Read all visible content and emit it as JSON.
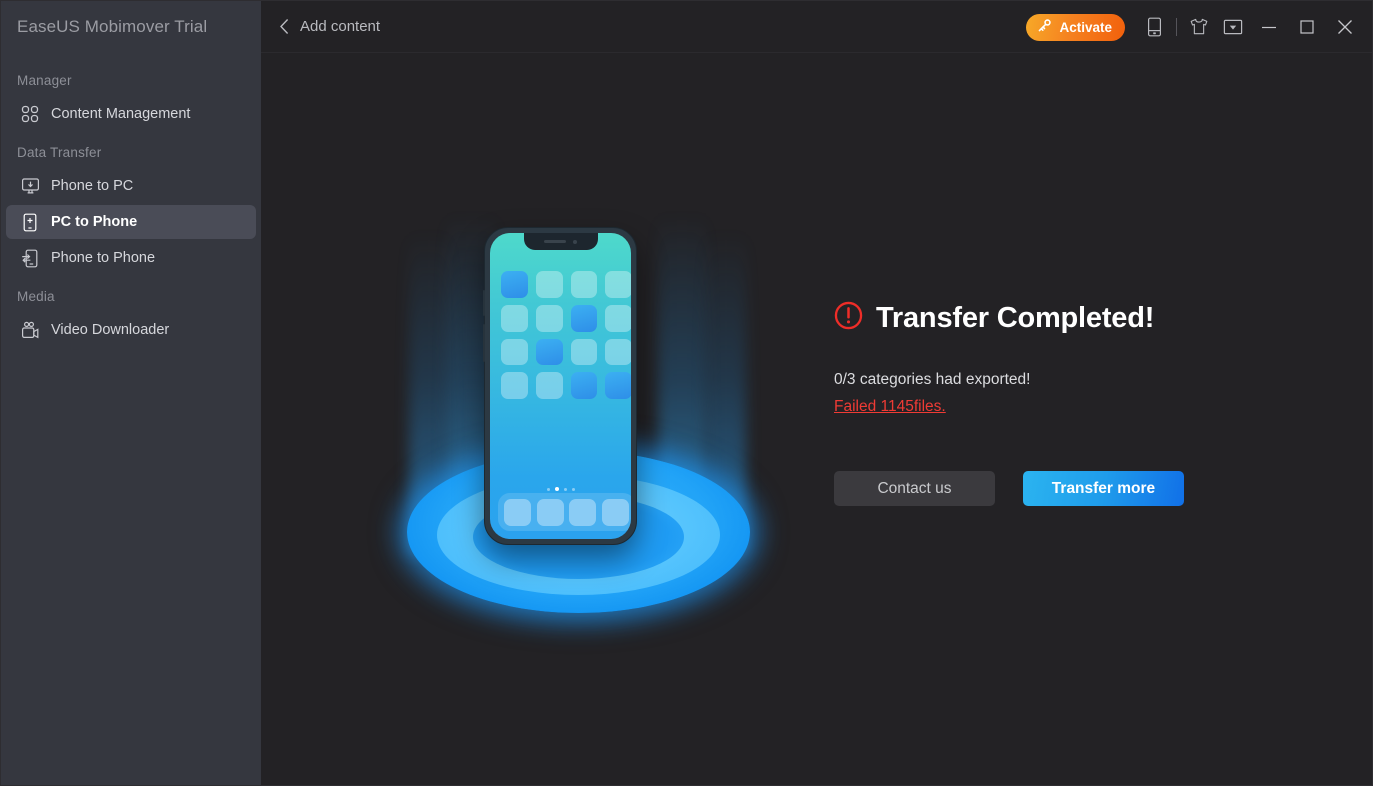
{
  "sidebar": {
    "brand": "EaseUS Mobimover Trial",
    "groups": [
      {
        "label": "Manager",
        "items": [
          {
            "label": "Content Management",
            "icon": "grid-icon",
            "active": false
          }
        ]
      },
      {
        "label": "Data Transfer",
        "items": [
          {
            "label": "Phone to PC",
            "icon": "monitor-download-icon",
            "active": false
          },
          {
            "label": "PC to Phone",
            "icon": "phone-plus-icon",
            "active": true
          },
          {
            "label": "Phone to Phone",
            "icon": "phone-transfer-icon",
            "active": false
          }
        ]
      },
      {
        "label": "Media",
        "items": [
          {
            "label": "Video Downloader",
            "icon": "video-camera-icon",
            "active": false
          }
        ]
      }
    ]
  },
  "topbar": {
    "back_label": "Add content",
    "back_icon": "chevron-left-icon",
    "activate_label": "Activate",
    "activate_icon": "key-icon",
    "device_icon": "phone-icon",
    "skin_icon": "tshirt-icon",
    "dropdown_icon": "dropdown-box-icon",
    "minimize_icon": "minimize-icon",
    "maximize_icon": "maximize-icon",
    "close_icon": "close-icon"
  },
  "result": {
    "status_icon": "error-exclamation-icon",
    "title": "Transfer Completed!",
    "summary": "0/3 categories had exported!",
    "failed_link": "Failed 1145files.",
    "contact_label": "Contact us",
    "transfer_more_label": "Transfer more"
  },
  "illustration": {
    "name": "phone-on-glowing-platform",
    "app_grid": [
      [
        "hl",
        "",
        "",
        ""
      ],
      [
        "",
        "",
        "hl",
        ""
      ],
      [
        "",
        "hl",
        "",
        ""
      ],
      [
        "",
        "",
        "hl",
        "hl"
      ]
    ],
    "dock_count": 4,
    "page_dots": 4,
    "active_dot": 2
  },
  "colors": {
    "sidebar_bg": "#35373f",
    "sidebar_active": "#4a4c57",
    "content_bg": "#232225",
    "accent_orange": "#f58220",
    "accent_blue": "#1f9ceb",
    "error_red": "#ef3b35",
    "phone_screen_top": "#4ed9cb",
    "phone_screen_bottom": "#2ba2ef",
    "platform_blue": "#21a3f7"
  }
}
